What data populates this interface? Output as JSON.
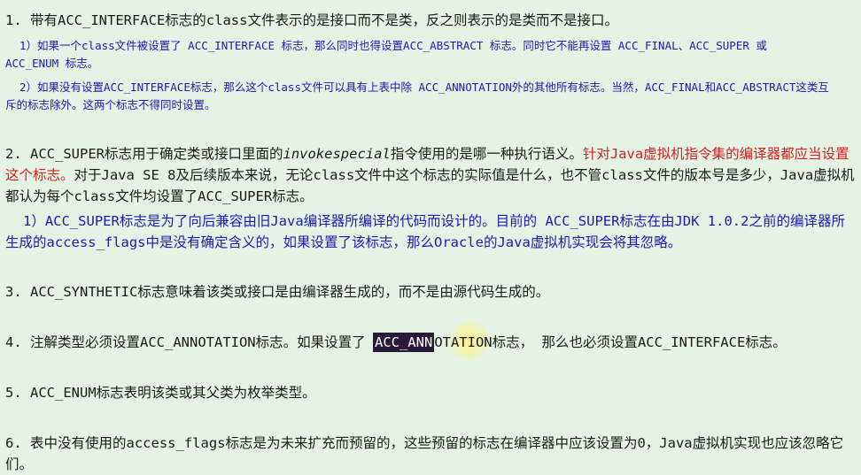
{
  "items": {
    "p1": {
      "main": "1. 带有ACC_INTERFACE标志的class文件表示的是接口而不是类，反之则表示的是类而不是接口。",
      "sub1": "1）如果一个class文件被设置了 ACC_INTERFACE 标志，那么同时也得设置ACC_ABSTRACT 标志。同时它不能再设置 ACC_FINAL、ACC_SUPER 或 ACC_ENUM 标志。",
      "sub2": "2）如果没有设置ACC_INTERFACE标志，那么这个class文件可以具有上表中除 ACC_ANNOTATION外的其他所有标志。当然，ACC_FINAL和ACC_ABSTRACT这类互斥的标志除外。这两个标志不得同时设置。"
    },
    "p2": {
      "part1": "2. ACC_SUPER标志用于确定类或接口里面的",
      "italic": "invokespecial",
      "part2": "指令使用的是哪一种执行语义。",
      "red": "针对Java虚拟机指令集的编译器都应当设置这个标志。",
      "part3": "对于Java SE 8及后续版本来说，无论class文件中这个标志的实际值是什么，也不管class文件的版本号是多少，Java虚拟机都认为每个class文件均设置了ACC_SUPER标志。",
      "sub1": "1）ACC_SUPER标志是为了向后兼容由旧Java编译器所编译的代码而设计的。目前的 ACC_SUPER标志在由JDK 1.0.2之前的编译器所生成的access_flags中是没有确定含义的，如果设置了该标志，那么Oracle的Java虚拟机实现会将其忽略。"
    },
    "p3": {
      "main": "3. ACC_SYNTHETIC标志意味着该类或接口是由编译器生成的，而不是由源代码生成的。"
    },
    "p4": {
      "before": "4. 注解类型必须设置ACC_ANNOTATION标志。如果设置了 ",
      "selected": "ACC_ANN",
      "after_sel": "OTATION标志，",
      "rest": " 那么也必须设置ACC_INTERFACE标志。"
    },
    "p5": {
      "main": "5. ACC_ENUM标志表明该类或其父类为枚举类型。"
    },
    "p6": {
      "main": "6. 表中没有使用的access_flags标志是为未来扩充而预留的，这些预留的标志在编译器中应该设置为0，Java虚拟机实现也应该忽略它们。"
    }
  },
  "colors": {
    "background": "#e4f3e4",
    "text": "#1a1a1a",
    "blue": "#1a1ab4",
    "red": "#d42020",
    "selection": "#2a1a3a"
  }
}
